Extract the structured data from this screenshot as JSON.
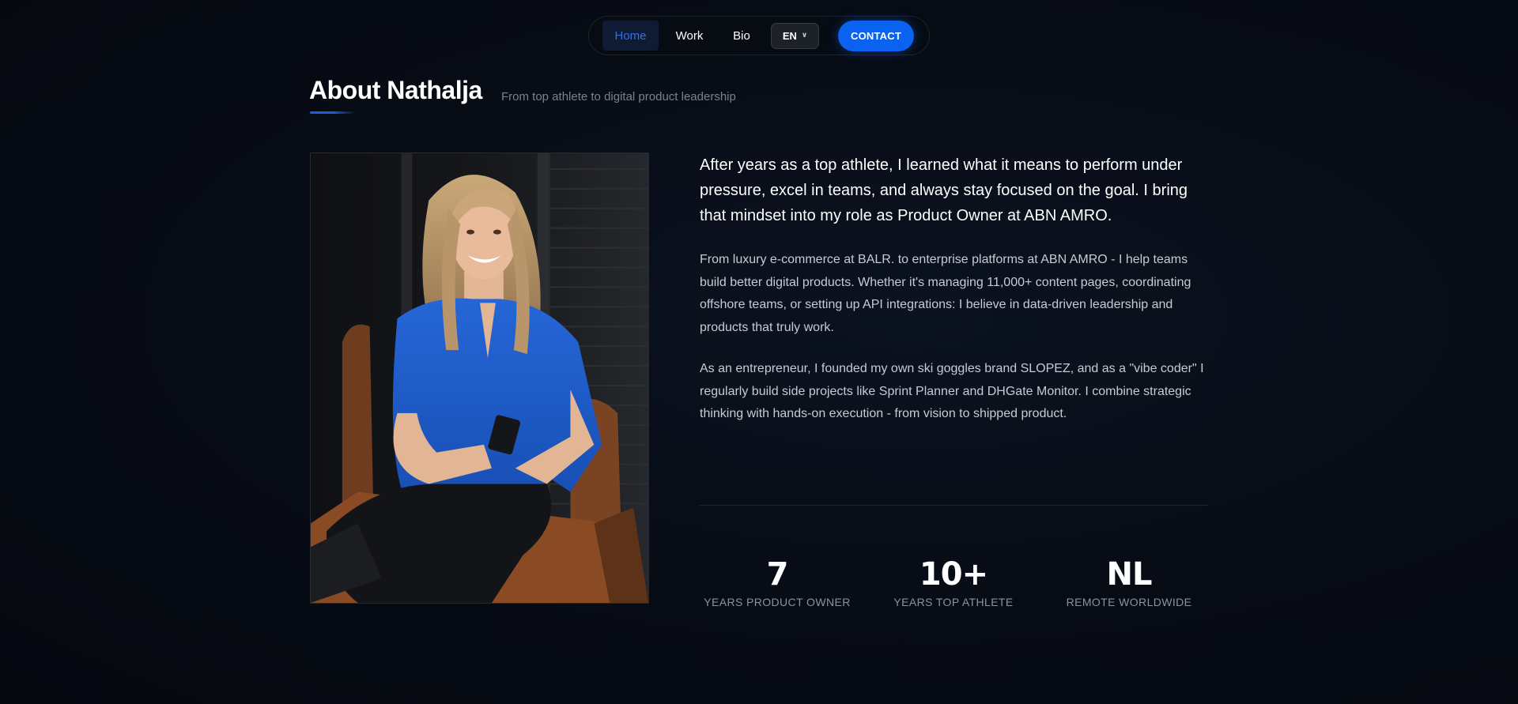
{
  "nav": {
    "items": [
      {
        "label": "Home",
        "active": true
      },
      {
        "label": "Work",
        "active": false
      },
      {
        "label": "Bio",
        "active": false
      }
    ],
    "language": {
      "selected": "EN",
      "icon": "chevron-down-icon"
    },
    "contact_label": "CONTACT"
  },
  "about": {
    "title": "About Nathalja",
    "subtitle": "From top athlete to digital product leadership",
    "lead": "After years as a top athlete, I learned what it means to perform under pressure, excel in teams, and always stay focused on the goal. I bring that mindset into my role as Product Owner at ABN AMRO.",
    "paragraphs": [
      "From luxury e-commerce at BALR. to enterprise platforms at ABN AMRO - I help teams build better digital products. Whether it's managing 11,000+ content pages, coordinating offshore teams, or setting up API integrations: I believe in data-driven leadership and products that truly work.",
      "As an entrepreneur, I founded my own ski goggles brand SLOPEZ, and as a \"vibe coder\" I regularly build side projects like Sprint Planner and DHGate Monitor. I combine strategic thinking with hands-on execution - from vision to shipped product."
    ]
  },
  "stats": [
    {
      "value": "7",
      "label": "YEARS PRODUCT OWNER"
    },
    {
      "value": "10+",
      "label": "YEARS TOP ATHLETE"
    },
    {
      "value": "NL",
      "label": "REMOTE WORLDWIDE"
    }
  ],
  "colors": {
    "background": "#060a13",
    "accent": "#0b62f0",
    "active_nav_text": "#2f72e6",
    "muted_text": "#7b818c"
  }
}
